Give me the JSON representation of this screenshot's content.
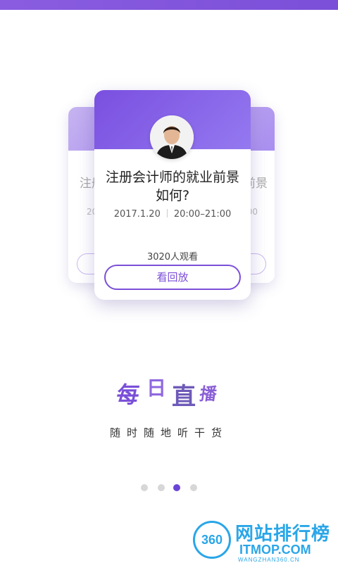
{
  "main_card": {
    "title_line1": "注册会计师的就业前景",
    "title_line2": "如何?",
    "date": "2017.1.20",
    "time": "20:00–21:00",
    "viewers": "3020人观看",
    "replay_label": "看回放"
  },
  "side_left": {
    "title_partial": "注册",
    "date_partial": "20"
  },
  "side_right": {
    "title_partial": "前景",
    "date_partial": "00"
  },
  "logo": {
    "c1": "每",
    "c2": "日",
    "c3": "直",
    "c4": "播"
  },
  "tagline": "随时随地听干货",
  "pager": {
    "total": 4,
    "active_index": 2
  },
  "watermark": {
    "badge": "360",
    "cn": "网站排行榜",
    "en": "ITMOP.COM",
    "sub": "WANGZHAN360.CN"
  },
  "colors": {
    "accent": "#7b4fd8",
    "watermark": "#2aa6e8"
  }
}
